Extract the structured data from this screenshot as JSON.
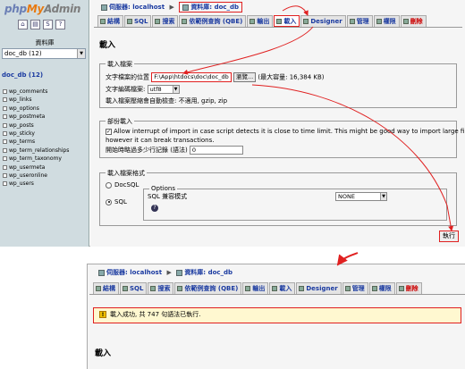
{
  "sidebar": {
    "logo": {
      "part1": "php",
      "part2": "My",
      "part3": "Admin"
    },
    "nav_icons": [
      "home-icon",
      "query-icon",
      "sql-icon",
      "docs-icon"
    ],
    "db_label": "資料庫",
    "db_select_value": "doc_db (12)",
    "db_heading": "doc_db (12)",
    "tables": [
      "wp_comments",
      "wp_links",
      "wp_options",
      "wp_postmeta",
      "wp_posts",
      "wp_sticky",
      "wp_terms",
      "wp_term_relationships",
      "wp_term_taxonomy",
      "wp_usermeta",
      "wp_useronline",
      "wp_users"
    ]
  },
  "top": {
    "breadcrumb": {
      "server_prefix": "伺服器:",
      "server": "localhost",
      "db_prefix": "資料庫:",
      "db": "doc_db"
    },
    "tabs": [
      {
        "label": "結構",
        "active": false,
        "danger": false
      },
      {
        "label": "SQL",
        "active": false,
        "danger": false
      },
      {
        "label": "搜索",
        "active": false,
        "danger": false
      },
      {
        "label": "依範例查詢 (QBE)",
        "active": false,
        "danger": false
      },
      {
        "label": "輸出",
        "active": false,
        "danger": false
      },
      {
        "label": "載入",
        "active": true,
        "danger": false
      },
      {
        "label": "Designer",
        "active": false,
        "danger": false
      },
      {
        "label": "管理",
        "active": false,
        "danger": false
      },
      {
        "label": "權限",
        "active": false,
        "danger": false
      },
      {
        "label": "刪除",
        "active": false,
        "danger": true
      }
    ],
    "page_title": "載入",
    "file_section": {
      "legend": "載入檔案",
      "file_label": "文字檔案的位置",
      "file_value": "F:\\App\\htdocs\\doc\\doc_db",
      "browse_label": "瀏覽...",
      "max_size": "(最大容量: 16,384 KB)",
      "charset_label": "文字編碼檔案:",
      "charset_value": "utf8",
      "compression_note": "載入檔案壓縮會自動檢查: 不適用, gzip, zip"
    },
    "partial_section": {
      "legend": "部份載入",
      "interrupt_text_1": "Allow interrupt of import in case script detects it is close to time limit. This might be good way to import large files,",
      "interrupt_text_2": "however it can break transactions.",
      "skip_label": "開始時略過多少行記錄 (語法)",
      "skip_value": "0"
    },
    "format_section": {
      "legend": "載入檔案格式",
      "formats": [
        "DocSQL",
        "SQL"
      ],
      "selected_format": "SQL",
      "options_legend": "Options",
      "sql_compat_label": "SQL 兼容模式",
      "sql_compat_value": "NONE"
    },
    "execute_label": "執行"
  },
  "bottom": {
    "breadcrumb": {
      "server_prefix": "伺服器:",
      "server": "localhost",
      "db_prefix": "資料庫:",
      "db": "doc_db"
    },
    "tabs": [
      {
        "label": "結構",
        "active": false,
        "danger": false
      },
      {
        "label": "SQL",
        "active": false,
        "danger": false
      },
      {
        "label": "搜索",
        "active": false,
        "danger": false
      },
      {
        "label": "依範例查詢 (QBE)",
        "active": false,
        "danger": false
      },
      {
        "label": "輸出",
        "active": false,
        "danger": false
      },
      {
        "label": "載入",
        "active": false,
        "danger": false
      },
      {
        "label": "Designer",
        "active": false,
        "danger": false
      },
      {
        "label": "管理",
        "active": false,
        "danger": false
      },
      {
        "label": "權限",
        "active": false,
        "danger": false
      },
      {
        "label": "刪除",
        "active": false,
        "danger": true
      }
    ],
    "success_message": "載入成功, 共 747 句語法已執行.",
    "page_title": "載入"
  },
  "colors": {
    "highlight": "#e02020",
    "link": "#1a3aa0",
    "sidebar_bg": "#d0dce0"
  }
}
